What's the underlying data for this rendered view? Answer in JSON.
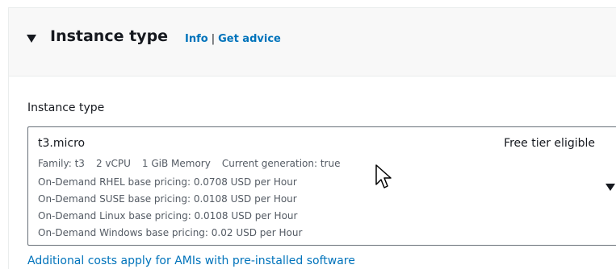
{
  "section": {
    "title": "Instance type",
    "info_link": "Info",
    "separator": "|",
    "advice_link": "Get advice"
  },
  "field": {
    "label": "Instance type"
  },
  "selected_instance": {
    "name": "t3.micro",
    "badge": "Free tier eligible",
    "family": "Family: t3",
    "vcpu": "2 vCPU",
    "memory": "1 GiB Memory",
    "generation": "Current generation: true",
    "pricing": [
      "On-Demand RHEL base pricing: 0.0708 USD per Hour",
      "On-Demand SUSE base pricing: 0.0108 USD per Hour",
      "On-Demand Linux base pricing: 0.0108 USD per Hour",
      "On-Demand Windows base pricing: 0.02 USD per Hour"
    ]
  },
  "footer": {
    "link_text": "Additional costs apply for AMIs with pre-installed software"
  },
  "colors": {
    "link": "#0073bb",
    "header_bg": "#f8f8f8",
    "text": "#16191f",
    "muted": "#545b64"
  },
  "icons": {
    "expand": "caret-down-icon",
    "select": "dropdown-arrow-icon",
    "pointer": "mouse-cursor-icon"
  }
}
